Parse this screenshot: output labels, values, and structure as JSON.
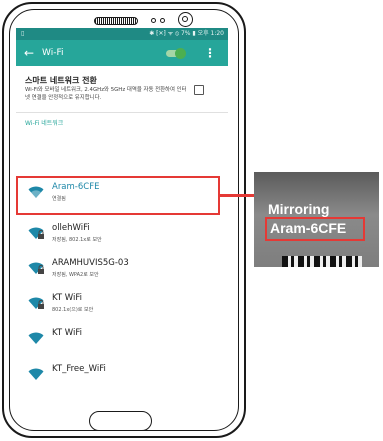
{
  "status_bar": {
    "left_icon": "notification-icon",
    "right_text": "✱ ⁅✕⁆ ᯤ ⦸ 7% ▮ 오후 1:20"
  },
  "app_bar": {
    "back_icon": "arrow-left-icon",
    "title": "Wi-Fi",
    "toggle_on": true,
    "more_icon": "more-vert-icon",
    "accent": "#26a69a"
  },
  "smart_network": {
    "title": "스마트 네트워크 전환",
    "description": "Wi-Fi와 모바일 네트워크, 2.4GHz와 5GHz 대역을 자동 전환하여 인터넷 연결을 안정적으로 유지합니다.",
    "checked": false
  },
  "section_header": "Wi-Fi 네트워크",
  "networks": [
    {
      "name": "Aram-6CFE",
      "status": "연결됨",
      "secured": false,
      "icon": "wifi-icon"
    },
    {
      "name": "ollehWiFi",
      "status": "저장됨, 802.1x로 보안",
      "secured": true,
      "icon": "wifi-lock-icon"
    },
    {
      "name": "ARAMHUVIS5G-03",
      "status": "저장됨, WPA2로 보안",
      "secured": true,
      "icon": "wifi-lock-icon"
    },
    {
      "name": "KT WiFi",
      "status": "802.1x(으)로 보안",
      "secured": true,
      "icon": "wifi-lock-icon"
    },
    {
      "name": "KT WiFi",
      "status": "",
      "secured": false,
      "icon": "wifi-icon"
    },
    {
      "name": "KT_Free_WiFi",
      "status": "",
      "secured": false,
      "icon": "wifi-icon"
    }
  ],
  "mirroring_inset": {
    "title": "Mirroring",
    "network_name": "Aram-6CFE",
    "highlight_color": "#e53935"
  }
}
